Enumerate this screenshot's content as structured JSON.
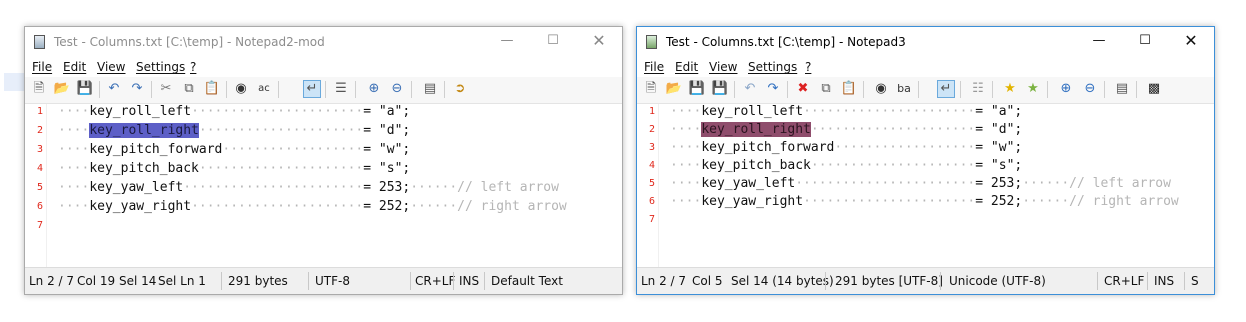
{
  "window1": {
    "title": "Test - Columns.txt [C:\\temp] - Notepad2-mod",
    "menu": [
      "File",
      "Edit",
      "View",
      "Settings",
      "?"
    ],
    "lines": [
      {
        "n": "1",
        "lead": "····",
        "name": "key_roll_left",
        "dots": "······················",
        "val": "= \"a\";",
        "after": ""
      },
      {
        "n": "2",
        "lead": "····",
        "name": "key_roll_right",
        "dots": "·····················",
        "val": "= \"d\";",
        "after": ""
      },
      {
        "n": "3",
        "lead": "····",
        "name": "key_pitch_forward",
        "dots": "··················",
        "val": "= \"w\";",
        "after": ""
      },
      {
        "n": "4",
        "lead": "····",
        "name": "key_pitch_back",
        "dots": "·····················",
        "val": "= \"s\";",
        "after": ""
      },
      {
        "n": "5",
        "lead": "····",
        "name": "key_yaw_left",
        "dots": "·······················",
        "val": "= 253;",
        "after": "······// left arrow"
      },
      {
        "n": "6",
        "lead": "····",
        "name": "key_yaw_right",
        "dots": "······················",
        "val": "= 252;",
        "after": "······// right arrow"
      },
      {
        "n": "7",
        "lead": "",
        "name": "",
        "dots": "",
        "val": "",
        "after": ""
      }
    ],
    "status": [
      "Ln 2 / 7",
      "Col 19",
      "Sel 14",
      "Sel Ln 1",
      "291 bytes",
      "UTF-8",
      "CR+LF",
      "INS",
      "Default Text"
    ]
  },
  "window2": {
    "title": "Test - Columns.txt [C:\\temp] - Notepad3",
    "menu": [
      "File",
      "Edit",
      "View",
      "Settings",
      "?"
    ],
    "lines": [
      {
        "n": "1",
        "lead": "····",
        "name": "key_roll_left",
        "dots": "······················",
        "val": "= \"a\";",
        "after": ""
      },
      {
        "n": "2",
        "lead": "····",
        "name": "key_roll_right",
        "dots": "·····················",
        "val": "= \"d\";",
        "after": ""
      },
      {
        "n": "3",
        "lead": "····",
        "name": "key_pitch_forward",
        "dots": "··················",
        "val": "= \"w\";",
        "after": ""
      },
      {
        "n": "4",
        "lead": "····",
        "name": "key_pitch_back",
        "dots": "·····················",
        "val": "= \"s\";",
        "after": ""
      },
      {
        "n": "5",
        "lead": "····",
        "name": "key_yaw_left",
        "dots": "·······················",
        "val": "= 253;",
        "after": "······// left arrow"
      },
      {
        "n": "6",
        "lead": "····",
        "name": "key_yaw_right",
        "dots": "······················",
        "val": "= 252;",
        "after": "······// right arrow"
      },
      {
        "n": "7",
        "lead": "",
        "name": "",
        "dots": "",
        "val": "",
        "after": ""
      }
    ],
    "status": [
      "Ln 2 / 7",
      "Col 5",
      "Sel 14 (14 bytes)",
      "291 bytes [UTF-8]",
      "Unicode (UTF-8)",
      "CR+LF",
      "INS",
      "S"
    ]
  },
  "colors": {
    "line_number": "#e0281c",
    "selection_notepad2": "#5d5fc7",
    "selection_notepad3": "#8f4d6c",
    "active_border": "#3c8fd8"
  },
  "icons": {
    "window1_toolbar": [
      "new-file",
      "open-folder",
      "save",
      "undo",
      "redo",
      "cut",
      "copy",
      "paste",
      "find",
      "replace",
      "word-wrap",
      "line-numbers",
      "zoom-in",
      "zoom-out",
      "scheme",
      "exit"
    ],
    "window2_toolbar": [
      "new-file",
      "open-folder",
      "save",
      "save-all",
      "undo",
      "redo",
      "delete",
      "copy",
      "paste",
      "find",
      "replace",
      "word-wrap",
      "view-whitespace",
      "bookmark",
      "add-bookmark",
      "zoom-in",
      "zoom-out",
      "customize",
      "terminal"
    ]
  }
}
